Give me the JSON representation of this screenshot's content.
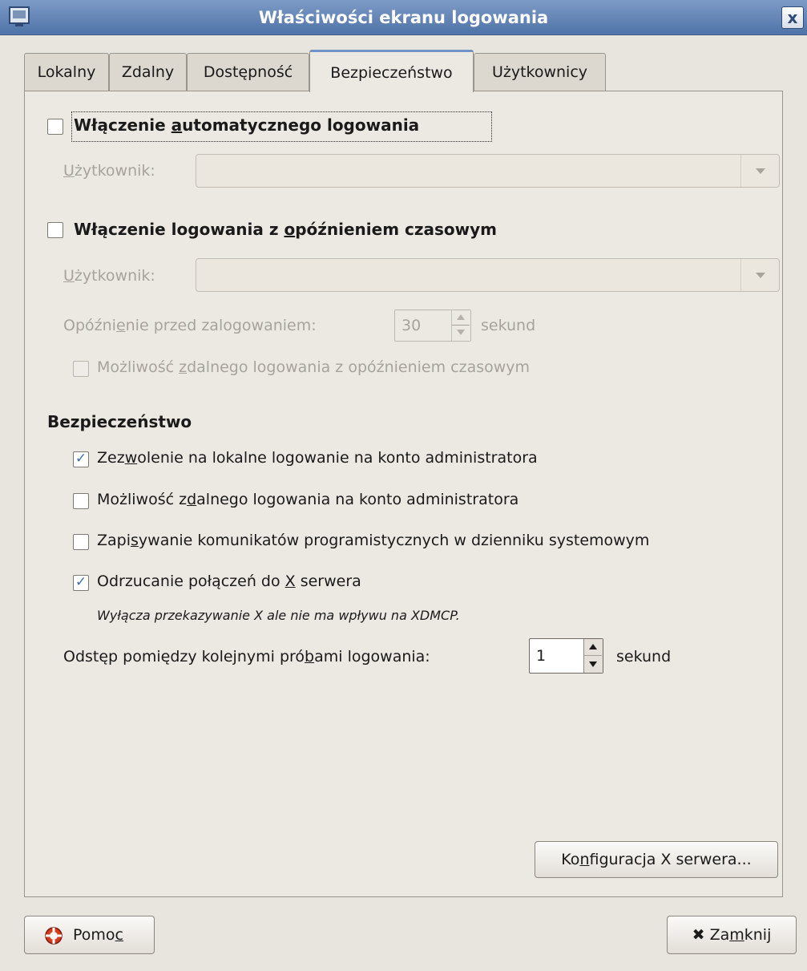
{
  "window": {
    "title": "Właściwości ekranu logowania",
    "close_glyph": "x"
  },
  "tabs": [
    {
      "label": "Lokalny"
    },
    {
      "label": "Zdalny"
    },
    {
      "label": "Dostępność"
    },
    {
      "label": "Bezpieczeństwo",
      "active": true
    },
    {
      "label": "Użytkownicy"
    }
  ],
  "autologin": {
    "checkbox_label_pre": "Włączenie ",
    "checkbox_label_mnemonic": "a",
    "checkbox_label_post": "utomatycznego logowania",
    "checked": false,
    "user_label_mnemonic": "U",
    "user_label_post": "żytkownik:",
    "user_value": ""
  },
  "timed_login": {
    "checkbox_label_pre": "Włączenie logowania z ",
    "checkbox_label_mnemonic": "o",
    "checkbox_label_post": "późnieniem czasowym",
    "checked": false,
    "user_label_mnemonic": "U",
    "user_label_post": "żytkownik:",
    "user_value": "",
    "delay_label_pre": "Opóźni",
    "delay_label_mnemonic": "e",
    "delay_label_post": "nie przed zalogowaniem:",
    "delay_value": "30",
    "delay_unit": "sekund",
    "remote_label_pre": "Możliwość ",
    "remote_label_mnemonic": "z",
    "remote_label_post": "dalnego logowania z opóźnieniem czasowym",
    "remote_checked": false
  },
  "security": {
    "heading": "Bezpieczeństwo",
    "options": [
      {
        "pre": "Zez",
        "mnemonic": "w",
        "post": "olenie na lokalne logowanie na konto administratora",
        "checked": true
      },
      {
        "pre": "Możliwość z",
        "mnemonic": "d",
        "post": "alnego logowania na konto administratora",
        "checked": false
      },
      {
        "pre": "Zapi",
        "mnemonic": "s",
        "post": "ywanie komunikatów programistycznych w dzienniku systemowym",
        "checked": false
      },
      {
        "pre": "Odrzucanie połączeń do ",
        "mnemonic": "X",
        "post": " serwera",
        "checked": true
      }
    ],
    "note": "Wyłącza przekazywanie X ale nie ma wpływu na XDMCP.",
    "retry_label_pre": "Odstęp pomiędzy kolejnymi pró",
    "retry_label_mnemonic": "b",
    "retry_label_post": "ami logowania:",
    "retry_value": "1",
    "retry_unit": "sekund",
    "check_glyph": "✓"
  },
  "xserver_button": {
    "pre": "Ko",
    "mnemonic": "n",
    "post": "figuracja X serwera..."
  },
  "footer": {
    "help_pre": "Pomo",
    "help_mnemonic": "c",
    "help_post": "",
    "close_pre": "Za",
    "close_mnemonic": "m",
    "close_post": "knij",
    "close_glyph": "✖"
  }
}
